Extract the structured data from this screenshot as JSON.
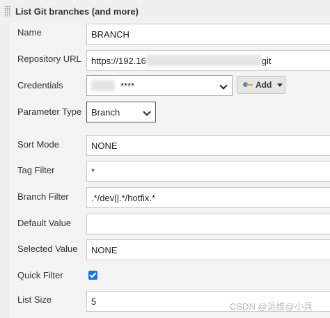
{
  "section": {
    "title": "List Git branches (and more)"
  },
  "fields": {
    "name": {
      "label": "Name",
      "value": "BRANCH"
    },
    "repository_url": {
      "label": "Repository URL",
      "prefix": "https://192.16",
      "suffix": "git"
    },
    "credentials": {
      "label": "Credentials",
      "value": "****",
      "add_label": "Add"
    },
    "parameter_type": {
      "label": "Parameter Type",
      "value": "Branch"
    },
    "sort_mode": {
      "label": "Sort Mode",
      "value": "NONE"
    },
    "tag_filter": {
      "label": "Tag Filter",
      "value": "*"
    },
    "branch_filter": {
      "label": "Branch Filter",
      "value": ".*/dev||.*/hotfix.*"
    },
    "default_value": {
      "label": "Default Value",
      "value": ""
    },
    "selected_value": {
      "label": "Selected Value",
      "value": "NONE"
    },
    "quick_filter": {
      "label": "Quick Filter",
      "checked": true
    },
    "list_size": {
      "label": "List Size",
      "value": "5"
    }
  },
  "watermark": "CSDN @运维@小兵",
  "icons": {
    "grip": "drag-handle-icon",
    "add": "key-icon",
    "checkbox": "checkmark-icon"
  },
  "colors": {
    "checkbox": "#1a73e8",
    "background": "#f0f0f0"
  }
}
